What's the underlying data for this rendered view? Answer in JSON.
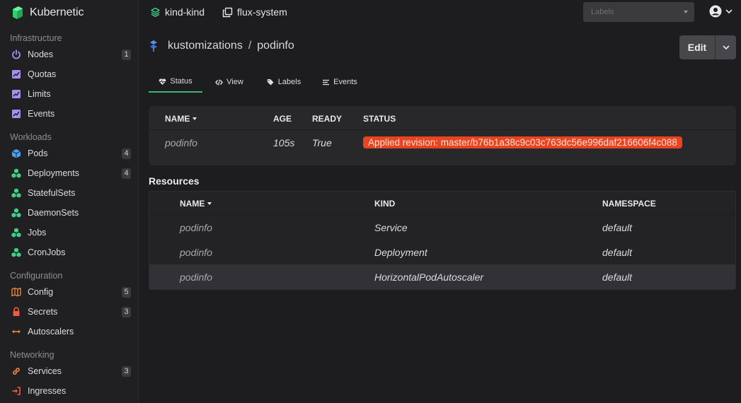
{
  "brand": {
    "name": "Kubernetic",
    "accent": "#2ed06f"
  },
  "sidebar": {
    "groups": [
      {
        "title": "Infrastructure",
        "items": [
          {
            "label": "Nodes",
            "badge": "1",
            "icon": "power-icon",
            "color": "#a98ef5"
          },
          {
            "label": "Quotas",
            "icon": "chart-icon",
            "color": "#a98ef5"
          },
          {
            "label": "Limits",
            "icon": "chart-icon",
            "color": "#a98ef5"
          },
          {
            "label": "Events",
            "icon": "chart-icon",
            "color": "#a98ef5"
          }
        ]
      },
      {
        "title": "Workloads",
        "items": [
          {
            "label": "Pods",
            "badge": "4",
            "icon": "cube-icon",
            "color": "#4aa3f0"
          },
          {
            "label": "Deployments",
            "badge": "4",
            "icon": "cubes-icon",
            "color": "#3fcf85"
          },
          {
            "label": "StatefulSets",
            "icon": "cubes-icon",
            "color": "#3fcf85"
          },
          {
            "label": "DaemonSets",
            "icon": "cubes-icon",
            "color": "#3fcf85"
          },
          {
            "label": "Jobs",
            "icon": "cubes-icon",
            "color": "#3fcf85"
          },
          {
            "label": "CronJobs",
            "icon": "cubes-icon",
            "color": "#3fcf85"
          }
        ]
      },
      {
        "title": "Configuration",
        "items": [
          {
            "label": "Config",
            "badge": "5",
            "icon": "map-icon",
            "color": "#f0853f"
          },
          {
            "label": "Secrets",
            "badge": "3",
            "icon": "lock-icon",
            "color": "#f05a3f"
          },
          {
            "label": "Autoscalers",
            "icon": "arrows-h-icon",
            "color": "#f0853f"
          }
        ]
      },
      {
        "title": "Networking",
        "items": [
          {
            "label": "Services",
            "badge": "3",
            "icon": "link-icon",
            "color": "#f0853f"
          },
          {
            "label": "Ingresses",
            "icon": "sign-in-icon",
            "color": "#f05a3f"
          }
        ]
      }
    ]
  },
  "topbar": {
    "cluster": "kind-kind",
    "namespace": "flux-system",
    "labels_placeholder": "Labels"
  },
  "page": {
    "breadcrumb_parent": "kustomizations",
    "breadcrumb_sep": "/",
    "breadcrumb_current": "podinfo",
    "edit_label": "Edit"
  },
  "tabs": [
    {
      "label": "Status",
      "icon": "heartbeat-icon",
      "active": true
    },
    {
      "label": "View",
      "icon": "code-icon"
    },
    {
      "label": "Labels",
      "icon": "tags-icon"
    },
    {
      "label": "Events",
      "icon": "list-icon"
    }
  ],
  "status_table": {
    "headers": {
      "name": "NAME",
      "age": "AGE",
      "ready": "READY",
      "status": "STATUS"
    },
    "row": {
      "name": "podinfo",
      "age": "105s",
      "ready": "True",
      "status": "Applied revision: master/b76b1a38c9c03c763dc56e996daf216606f4c088"
    },
    "status_color": "#e9441f"
  },
  "resources": {
    "title": "Resources",
    "headers": {
      "name": "NAME",
      "kind": "KIND",
      "namespace": "NAMESPACE"
    },
    "rows": [
      {
        "name": "podinfo",
        "kind": "Service",
        "namespace": "default"
      },
      {
        "name": "podinfo",
        "kind": "Deployment",
        "namespace": "default"
      },
      {
        "name": "podinfo",
        "kind": "HorizontalPodAutoscaler",
        "namespace": "default"
      }
    ]
  }
}
